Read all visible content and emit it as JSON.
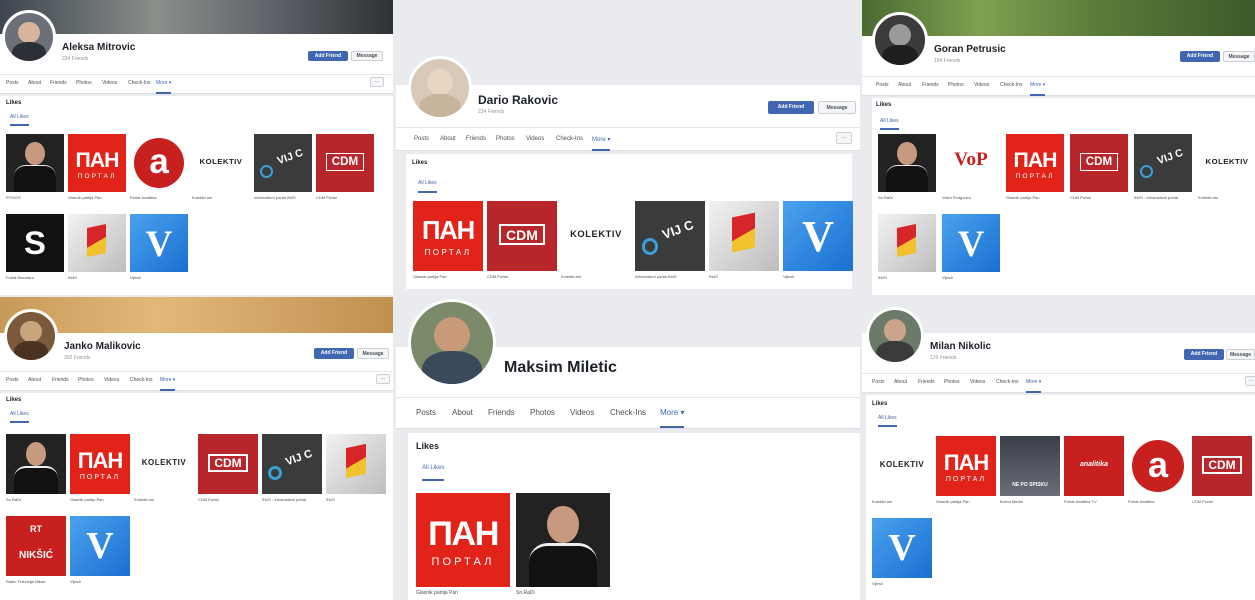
{
  "colors": {
    "accent": "#4267b2",
    "pan_red": "#e2231a",
    "cdm_red": "#b7262b",
    "dark_tile": "#3a3b3c",
    "v_blue": "#1a6fd1"
  },
  "profiles": [
    {
      "name": "Aleksa Mitrovic",
      "sub": "224 Friends",
      "add_friend": "Add Friend",
      "message": "Message",
      "tabs": [
        "Posts",
        "About",
        "Friends",
        "Photos",
        "Videos",
        "Check-Ins",
        "More ▾"
      ],
      "likes_title": "Likes",
      "likes_tab": "All Likes",
      "tiles": [
        {
          "kind": "person",
          "caption": "RTS/GS"
        },
        {
          "kind": "pan",
          "caption": "Glasnik partija Pan"
        },
        {
          "kind": "a",
          "caption": "Portal Analitika"
        },
        {
          "kind": "kolektiv",
          "caption": "Kolektiv.me"
        },
        {
          "kind": "vijesti",
          "caption": "Informativni portal IN4S"
        },
        {
          "kind": "cdm",
          "caption": "CDM Portal"
        },
        {
          "kind": "s",
          "caption": "Portal Standard"
        },
        {
          "kind": "flag",
          "caption": "IN4S"
        },
        {
          "kind": "v",
          "caption": "Vijesti"
        }
      ],
      "overflow": "···"
    },
    {
      "name": "Dario Rakovic",
      "sub": "224 Friends",
      "add_friend": "Add Friend",
      "message": "Message",
      "tabs": [
        "Posts",
        "About",
        "Friends",
        "Photos",
        "Videos",
        "Check-Ins",
        "More ▾"
      ],
      "likes_title": "Likes",
      "likes_tab": "All Likes",
      "tiles": [
        {
          "kind": "pan",
          "caption": "Glasnik partija Pan"
        },
        {
          "kind": "cdm",
          "caption": "CDM Portal"
        },
        {
          "kind": "kolektiv",
          "caption": "Kolektiv.me"
        },
        {
          "kind": "vijesti",
          "caption": "Informativni portal IN4S"
        },
        {
          "kind": "flag",
          "caption": "IN4S"
        },
        {
          "kind": "v",
          "caption": "Vijesti"
        }
      ],
      "overflow": "···"
    },
    {
      "name": "Goran Petrusic",
      "sub": "194 Friends",
      "add_friend": "Add Friend",
      "message": "Message",
      "tabs": [
        "Posts",
        "About",
        "Friends",
        "Photos",
        "Videos",
        "Check-Ins",
        "More ▾"
      ],
      "likes_title": "Likes",
      "likes_tab": "All Likes",
      "tiles": [
        {
          "kind": "person",
          "caption": "Sn.RaDi"
        },
        {
          "kind": "vop",
          "caption": "Volim Podgoricu"
        },
        {
          "kind": "pan",
          "caption": "Glasnik partija Pan"
        },
        {
          "kind": "cdm",
          "caption": "CDM Portal"
        },
        {
          "kind": "vijesti",
          "caption": "IN4S - informativni portal"
        },
        {
          "kind": "kolektiv",
          "caption": "Kolektiv.me"
        },
        {
          "kind": "flag",
          "caption": "IN4S"
        },
        {
          "kind": "v",
          "caption": "Vijesti"
        }
      ],
      "overflow": "···"
    },
    {
      "name": "Janko Malikovic",
      "sub": "302 Friends",
      "add_friend": "Add Friend",
      "message": "Message",
      "tabs": [
        "Posts",
        "About",
        "Friends",
        "Photos",
        "Videos",
        "Check-Ins",
        "More ▾"
      ],
      "likes_title": "Likes",
      "likes_tab": "All Likes",
      "tiles": [
        {
          "kind": "person",
          "caption": "Sn.RaDi"
        },
        {
          "kind": "pan",
          "caption": "Glasnik partija Pan"
        },
        {
          "kind": "kolektiv",
          "caption": "Kolektiv.me"
        },
        {
          "kind": "cdm",
          "caption": "CDM Portal"
        },
        {
          "kind": "vijesti",
          "caption": "IN4S - informativni portal"
        },
        {
          "kind": "flag",
          "caption": "IN4S"
        },
        {
          "kind": "niksic",
          "caption": "Radio Televizija Niksic"
        },
        {
          "kind": "v",
          "caption": "Vijesti"
        }
      ],
      "overflow": "···"
    },
    {
      "name": "Maksim Miletic",
      "tabs": [
        "Posts",
        "About",
        "Friends",
        "Photos",
        "Videos",
        "Check-Ins",
        "More ▾"
      ],
      "likes_title": "Likes",
      "likes_tab": "All Likes",
      "tiles": [
        {
          "kind": "pan",
          "caption": "Glasnik partija Pan"
        },
        {
          "kind": "person",
          "caption": "Sn.RaDi"
        }
      ]
    },
    {
      "name": "Milan Nikolic",
      "sub": "176 Friends",
      "add_friend": "Add Friend",
      "message": "Message",
      "tabs": [
        "Posts",
        "About",
        "Friends",
        "Photos",
        "Videos",
        "Check-Ins",
        "More ▾"
      ],
      "likes_title": "Likes",
      "likes_tab": "All Likes",
      "tiles": [
        {
          "kind": "kolektiv",
          "caption": "Kolektiv.me"
        },
        {
          "kind": "pan",
          "caption": "Glasnik partija Pan"
        },
        {
          "kind": "people",
          "caption": "Borba Media"
        },
        {
          "kind": "redtext",
          "caption": "Portal Analitika TV"
        },
        {
          "kind": "a",
          "caption": "Portal Analitika"
        },
        {
          "kind": "cdm",
          "caption": "CDM Portal"
        },
        {
          "kind": "v",
          "caption": "Vijesti"
        }
      ],
      "overflow": "···"
    }
  ],
  "tile_labels": {
    "pan_top": "ПАН",
    "pan_bottom": "ПОРТАЛ",
    "cdm": "CDM",
    "kolektiv": "KOLEKTIV",
    "vijesti": "VIJ C",
    "a": "a",
    "s": "S",
    "v": "V",
    "vop": "VoP",
    "niksic": "NIKŠIĆ",
    "niksic_top": "RT",
    "redtext": "analitika",
    "people": "NE PO SPISKU"
  }
}
